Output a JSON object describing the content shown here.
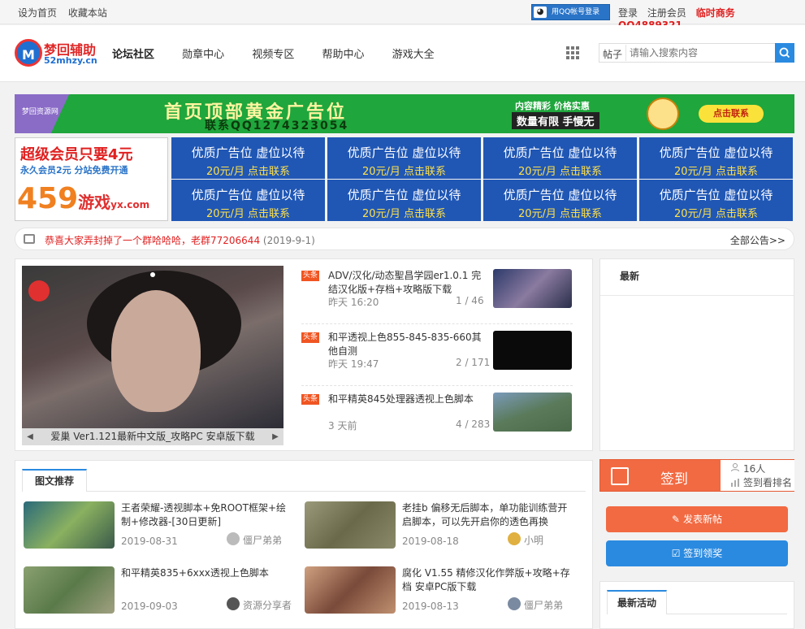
{
  "topbar": {
    "set_home": "设为首页",
    "bookmark": "收藏本站",
    "qq_login": "用QQ帐号登录",
    "login": "登录",
    "register": "注册会员",
    "business": "临时商务QQ4889321"
  },
  "logo": {
    "name": "梦回辅助",
    "domain": "52mhzy.cn",
    "mark": "M"
  },
  "nav": [
    "论坛社区",
    "勋章中心",
    "视频专区",
    "帮助中心",
    "游戏大全"
  ],
  "search": {
    "category": "帖子",
    "placeholder": "请输入搜索内容"
  },
  "banner": {
    "corner": "梦回资源网",
    "title": "首页顶部黄金广告位",
    "contact": "联系QQ1274323054",
    "slogan": "内容精彩 价格实惠",
    "limited": "数量有限 手慢无",
    "cta": "点击联系"
  },
  "vip_ad": {
    "line1": "超级会员只要4元",
    "line2": "永久会员2元 分站免费开通",
    "brand": "459",
    "brand_suffix": "游戏",
    "brand_domain": "yx.com"
  },
  "ad_slots": [
    {
      "title": "优质广告位 虚位以待",
      "price": "20元/月 点击联系"
    },
    {
      "title": "优质广告位 虚位以待",
      "price": "20元/月 点击联系"
    },
    {
      "title": "优质广告位 虚位以待",
      "price": "20元/月 点击联系"
    },
    {
      "title": "优质广告位 虚位以待",
      "price": "20元/月 点击联系"
    },
    {
      "title": "优质广告位 虚位以待",
      "price": "20元/月 点击联系"
    },
    {
      "title": "优质广告位 虚位以待",
      "price": "20元/月 点击联系"
    },
    {
      "title": "优质广告位 虚位以待",
      "price": "20元/月 点击联系"
    },
    {
      "title": "优质广告位 虚位以待",
      "price": "20元/月 点击联系"
    }
  ],
  "notice": {
    "text": "恭喜大家弄封掉了一个群哈哈哈，老群77206644",
    "date": "(2019-9-1)",
    "all": "全部公告>>"
  },
  "slider": {
    "caption": "爱巢 Ver1.121最新中文版_攻略PC 安卓版下载",
    "prev": "◀",
    "next": "▶"
  },
  "headlines": [
    {
      "tag": "头条",
      "title": "ADV/汉化/动态聖昌学园er1.0.1 完结汉化版+存档+攻略版下载",
      "time": "昨天 16:20",
      "count": "1 / 46",
      "thumb_color": "#3a3f5a"
    },
    {
      "tag": "头条",
      "title": "和平透视上色855-845-835-660其他自测",
      "time": "昨天 19:47",
      "count": "2 / 171",
      "thumb_color": "#0a0a0a"
    },
    {
      "tag": "头条",
      "title": "和平精英845处理器透视上色脚本",
      "time": "3 天前",
      "count": "4 / 283",
      "thumb_color": "#5f7a6a"
    }
  ],
  "latest": {
    "title": "最新"
  },
  "pic_rec": {
    "tab": "图文推荐",
    "items": [
      {
        "title": "王者荣耀-透视脚本+免ROOT框架+绘制+修改器-[30日更新]",
        "date": "2019-08-31",
        "author": "僵尸弟弟",
        "thumb_color": "#3b7a6a"
      },
      {
        "title": "老挂b 偏移无后脚本，单功能训练营开启脚本，可以先开启你的透色再换",
        "date": "2019-08-18",
        "author": "小明",
        "thumb_color": "#7d7a5c"
      },
      {
        "title": "和平精英835+6xxx透视上色脚本",
        "date": "2019-09-03",
        "author": "资源分享者",
        "thumb_color": "#6a8a4a"
      },
      {
        "title": "腐化 V1.55 精修汉化作弊版+攻略+存档 安卓PC版下载",
        "date": "2019-08-13",
        "author": "僵尸弟弟",
        "thumb_color": "#8a5a4a"
      }
    ]
  },
  "sign": {
    "label": "签到",
    "count": "16人",
    "rank": "签到看排名"
  },
  "buttons": {
    "new_post": "发表新帖",
    "sign_reward": "签到领奖"
  },
  "activity": {
    "title": "最新活动"
  },
  "colors": {
    "accent": "#2a8ae0",
    "red": "#e02020",
    "sign": "#f26a42",
    "ad_blue": "#2057b5",
    "banner_green": "#1fa63c"
  }
}
